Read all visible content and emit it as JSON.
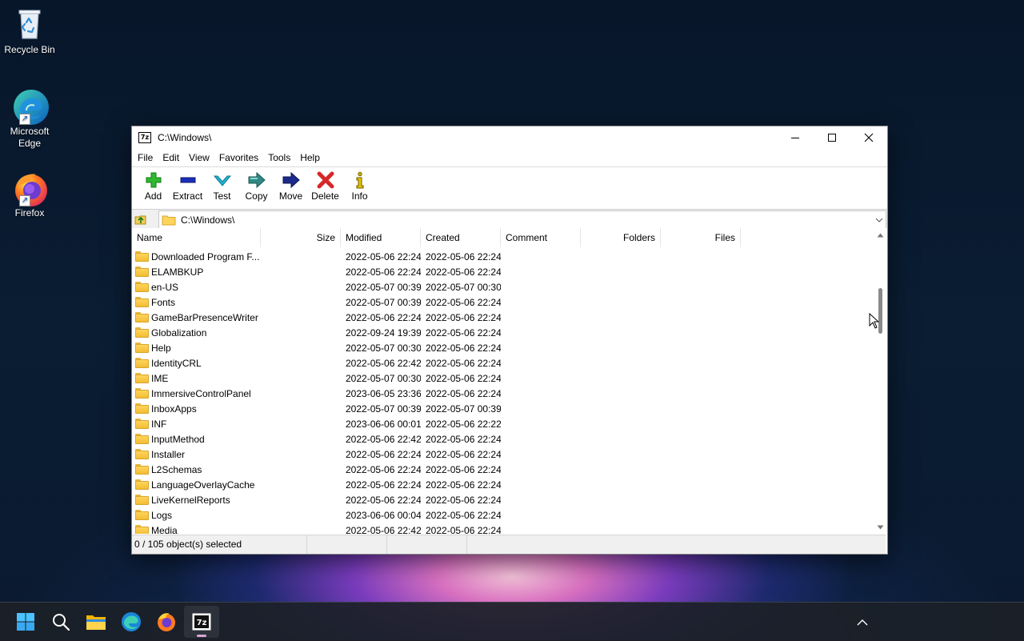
{
  "desktop": {
    "icons": [
      {
        "label": "Recycle Bin"
      },
      {
        "label": "Microsoft Edge"
      },
      {
        "label": "Firefox"
      }
    ]
  },
  "window": {
    "title": "C:\\Windows\\",
    "app_icon_text": "7z",
    "menu": [
      "File",
      "Edit",
      "View",
      "Favorites",
      "Tools",
      "Help"
    ],
    "toolbar": [
      {
        "label": "Add",
        "icon": "plus-icon",
        "color": "#2eb82e"
      },
      {
        "label": "Extract",
        "icon": "minus-icon",
        "color": "#1a2fb8"
      },
      {
        "label": "Test",
        "icon": "check-icon",
        "color": "#1fb5d6"
      },
      {
        "label": "Copy",
        "icon": "copy-arrow-icon",
        "color": "#2f8a86"
      },
      {
        "label": "Move",
        "icon": "move-arrow-icon",
        "color": "#1c2a8c"
      },
      {
        "label": "Delete",
        "icon": "delete-x-icon",
        "color": "#d62828"
      },
      {
        "label": "Info",
        "icon": "info-icon",
        "color": "#c8a800"
      }
    ],
    "address": "C:\\Windows\\",
    "columns": [
      "Name",
      "Size",
      "Modified",
      "Created",
      "Comment",
      "Folders",
      "Files"
    ],
    "rows": [
      {
        "name": "Downloaded Program F...",
        "modified": "2022-05-06 22:24",
        "created": "2022-05-06 22:24"
      },
      {
        "name": "ELAMBKUP",
        "modified": "2022-05-06 22:24",
        "created": "2022-05-06 22:24"
      },
      {
        "name": "en-US",
        "modified": "2022-05-07 00:39",
        "created": "2022-05-07 00:30"
      },
      {
        "name": "Fonts",
        "modified": "2022-05-07 00:39",
        "created": "2022-05-06 22:24"
      },
      {
        "name": "GameBarPresenceWriter",
        "modified": "2022-05-06 22:24",
        "created": "2022-05-06 22:24"
      },
      {
        "name": "Globalization",
        "modified": "2022-09-24 19:39",
        "created": "2022-05-06 22:24"
      },
      {
        "name": "Help",
        "modified": "2022-05-07 00:30",
        "created": "2022-05-06 22:24"
      },
      {
        "name": "IdentityCRL",
        "modified": "2022-05-06 22:42",
        "created": "2022-05-06 22:24"
      },
      {
        "name": "IME",
        "modified": "2022-05-07 00:30",
        "created": "2022-05-06 22:24"
      },
      {
        "name": "ImmersiveControlPanel",
        "modified": "2023-06-05 23:36",
        "created": "2022-05-06 22:24"
      },
      {
        "name": "InboxApps",
        "modified": "2022-05-07 00:39",
        "created": "2022-05-07 00:39"
      },
      {
        "name": "INF",
        "modified": "2023-06-06 00:01",
        "created": "2022-05-06 22:22"
      },
      {
        "name": "InputMethod",
        "modified": "2022-05-06 22:42",
        "created": "2022-05-06 22:24"
      },
      {
        "name": "Installer",
        "modified": "2022-05-06 22:24",
        "created": "2022-05-06 22:24"
      },
      {
        "name": "L2Schemas",
        "modified": "2022-05-06 22:24",
        "created": "2022-05-06 22:24"
      },
      {
        "name": "LanguageOverlayCache",
        "modified": "2022-05-06 22:24",
        "created": "2022-05-06 22:24"
      },
      {
        "name": "LiveKernelReports",
        "modified": "2022-05-06 22:24",
        "created": "2022-05-06 22:24"
      },
      {
        "name": "Logs",
        "modified": "2023-06-06 00:04",
        "created": "2022-05-06 22:24"
      },
      {
        "name": "Media",
        "modified": "2022-05-06 22:42",
        "created": "2022-05-06 22:24"
      }
    ],
    "status": "0 / 105 object(s) selected"
  },
  "taskbar": {
    "items": [
      "start-icon",
      "search-icon",
      "file-explorer-icon",
      "edge-icon",
      "firefox-icon",
      "7zip-icon"
    ],
    "active": "7zip-icon"
  }
}
